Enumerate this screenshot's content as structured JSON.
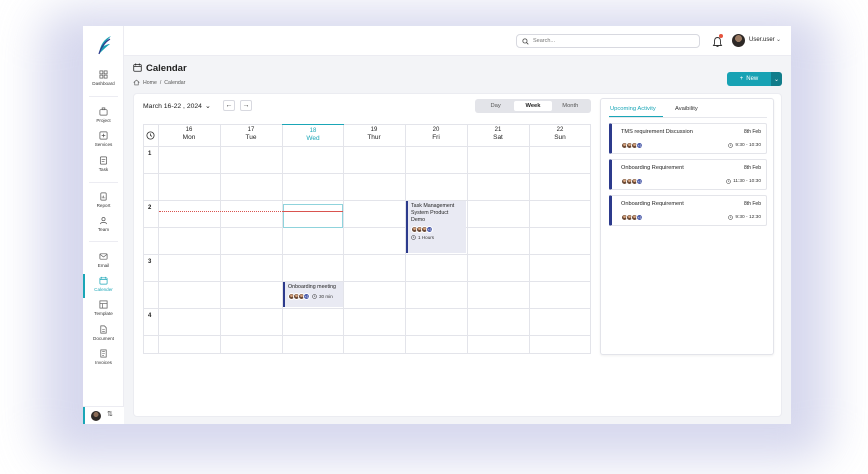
{
  "sidebar": {
    "items": [
      {
        "label": "Dashboard",
        "icon": "grid-icon"
      },
      {
        "label": "Project",
        "icon": "briefcase-icon"
      },
      {
        "label": "Services",
        "icon": "services-icon"
      },
      {
        "label": "Task",
        "icon": "task-icon"
      },
      {
        "label": "Report",
        "icon": "report-icon"
      },
      {
        "label": "Team",
        "icon": "team-icon"
      },
      {
        "label": "Email",
        "icon": "mail-icon"
      },
      {
        "label": "Calender",
        "icon": "calendar-icon"
      },
      {
        "label": "Template",
        "icon": "template-icon"
      },
      {
        "label": "Document",
        "icon": "document-icon"
      },
      {
        "label": "Invoices",
        "icon": "invoice-icon"
      }
    ]
  },
  "topbar": {
    "search_placeholder": "Search...",
    "user_name": "User.user"
  },
  "header": {
    "title": "Calendar",
    "breadcrumb_home": "Home",
    "breadcrumb_sep": "/",
    "breadcrumb_current": "Calendar",
    "new_button": "New"
  },
  "calendar": {
    "range_label": "March 16-22 , 2024",
    "views": [
      "Day",
      "Week",
      "Month"
    ],
    "active_view": "Week",
    "days": [
      {
        "num": "16",
        "name": "Mon"
      },
      {
        "num": "17",
        "name": "Tue"
      },
      {
        "num": "18",
        "name": "Wed"
      },
      {
        "num": "19",
        "name": "Thur"
      },
      {
        "num": "20",
        "name": "Fri"
      },
      {
        "num": "21",
        "name": "Sat"
      },
      {
        "num": "22",
        "name": "Sun"
      }
    ],
    "hours": [
      "1",
      "2",
      "3",
      "4"
    ],
    "events": [
      {
        "title_lines": [
          "Task Management",
          "System Product",
          "Demo"
        ],
        "more": "+3",
        "duration": "1 Hours"
      },
      {
        "title": "Onboarding meeting",
        "more": "+3",
        "duration": "30 min"
      }
    ]
  },
  "activity": {
    "tabs": [
      "Upcoming Activity",
      "Avaibility"
    ],
    "items": [
      {
        "title": "TMS requirement Discussion",
        "date": "8th Feb",
        "time": "9:30 - 10:30",
        "more": "+3"
      },
      {
        "title": "Onboarding Requirement",
        "date": "8th Feb",
        "time": "11:30 - 10:30",
        "more": "+3"
      },
      {
        "title": "Onboarding Requirement",
        "date": "8th Feb",
        "time": "9:30 - 12:30",
        "more": "+3"
      }
    ]
  },
  "colors": {
    "accent": "#1aa6b7",
    "event_border": "#2c3a8c",
    "now_line": "#d9534f"
  }
}
